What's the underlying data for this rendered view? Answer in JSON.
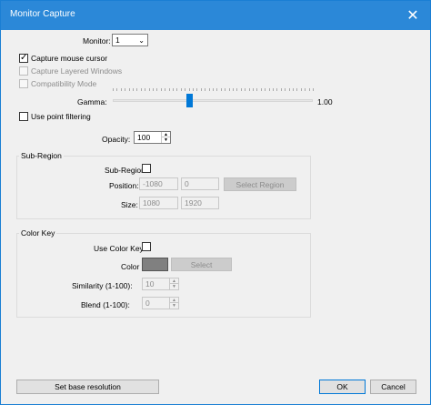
{
  "window": {
    "title": "Monitor Capture"
  },
  "monitor": {
    "label": "Monitor:",
    "value": "1"
  },
  "capture_mouse": {
    "label": "Capture mouse cursor",
    "checked": true
  },
  "capture_layered": {
    "label": "Capture Layered Windows"
  },
  "compat_mode": {
    "label": "Compatibility Mode"
  },
  "gamma": {
    "label": "Gamma:",
    "value_text": "1.00",
    "level": 0.38
  },
  "point_filter": {
    "label": "Use point filtering"
  },
  "opacity": {
    "label": "Opacity:",
    "value": "100"
  },
  "subregion_group": {
    "title": "Sub-Region",
    "enable_label": "Sub-Region",
    "position_label": "Position:",
    "position_x": "-1080",
    "position_y": "0",
    "select_label": "Select Region",
    "size_label": "Size:",
    "size_w": "1080",
    "size_h": "1920"
  },
  "colorkey_group": {
    "title": "Color Key",
    "use_label": "Use Color Key:",
    "color_label": "Color",
    "color_value": "#808080",
    "select_label": "Select",
    "similarity_label": "Similarity (1-100):",
    "similarity_value": "10",
    "blend_label": "Blend (1-100):",
    "blend_value": "0"
  },
  "footer": {
    "base_res_label": "Set base resolution",
    "ok_label": "OK",
    "cancel_label": "Cancel"
  }
}
